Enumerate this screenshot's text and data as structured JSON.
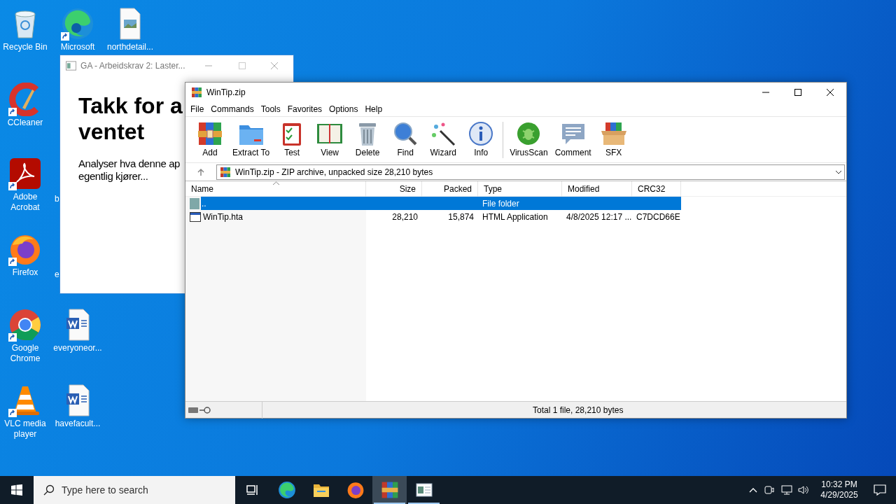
{
  "desktop_icons": [
    {
      "label": "Recycle Bin",
      "kind": "recycle",
      "shortcut": false
    },
    {
      "label": "Microsoft",
      "kind": "edge",
      "shortcut": true
    },
    {
      "label": "northdetail...",
      "kind": "image",
      "shortcut": false
    },
    {
      "label": "CCleaner",
      "kind": "ccleaner",
      "shortcut": true
    },
    {
      "label": "Adobe Acrobat",
      "kind": "acrobat",
      "shortcut": true
    },
    {
      "label": "b",
      "kind": "hidden"
    },
    {
      "label": "Firefox",
      "kind": "firefox",
      "shortcut": true
    },
    {
      "label": "e",
      "kind": "hidden"
    },
    {
      "label": "Google Chrome",
      "kind": "chrome",
      "shortcut": true
    },
    {
      "label": "everyoneor...",
      "kind": "word",
      "shortcut": false
    },
    {
      "label": "VLC media player",
      "kind": "vlc",
      "shortcut": true
    },
    {
      "label": "havefacult...",
      "kind": "word",
      "shortcut": false
    }
  ],
  "back_window": {
    "title": "GA - Arbeidskrav 2: Laster...",
    "heading_lines": [
      "Takk for a",
      "ventet"
    ],
    "text_lines": [
      "Analyser hva denne ap",
      "egentlig kjører..."
    ]
  },
  "winrar": {
    "title": "WinTip.zip",
    "menu": [
      "File",
      "Commands",
      "Tools",
      "Favorites",
      "Options",
      "Help"
    ],
    "toolbar": [
      {
        "label": "Add",
        "kind": "add"
      },
      {
        "label": "Extract To",
        "kind": "extract"
      },
      {
        "label": "Test",
        "kind": "test"
      },
      {
        "label": "View",
        "kind": "view"
      },
      {
        "label": "Delete",
        "kind": "delete"
      },
      {
        "label": "Find",
        "kind": "find"
      },
      {
        "label": "Wizard",
        "kind": "wizard"
      },
      {
        "label": "Info",
        "kind": "info"
      },
      {
        "label": "VirusScan",
        "kind": "virus"
      },
      {
        "label": "Comment",
        "kind": "comment"
      },
      {
        "label": "SFX",
        "kind": "sfx"
      }
    ],
    "address": "WinTip.zip - ZIP archive, unpacked size 28,210 bytes",
    "columns": [
      "Name",
      "Size",
      "Packed",
      "Type",
      "Modified",
      "CRC32"
    ],
    "rows": [
      {
        "kind": "folder",
        "name": "..",
        "size": "",
        "packed": "",
        "type": "File folder",
        "modified": "",
        "crc32": "",
        "selected": true
      },
      {
        "kind": "file",
        "name": "WinTip.hta",
        "size": "28,210",
        "packed": "15,874",
        "type": "HTML Application",
        "modified": "4/8/2025 12:17 ...",
        "crc32": "C7DCD66E",
        "selected": false
      }
    ],
    "status": "Total 1 file, 28,210 bytes"
  },
  "taskbar": {
    "search_placeholder": "Type here to search",
    "apps": [
      {
        "kind": "taskview",
        "selected": false,
        "running": false
      },
      {
        "kind": "edge",
        "selected": false,
        "running": false
      },
      {
        "kind": "explorer",
        "selected": false,
        "running": false
      },
      {
        "kind": "firefox",
        "selected": false,
        "running": false
      },
      {
        "kind": "winrar",
        "selected": true,
        "running": true
      },
      {
        "kind": "hta",
        "selected": false,
        "running": true
      }
    ],
    "time": "10:32 PM",
    "date": "4/29/2025"
  }
}
